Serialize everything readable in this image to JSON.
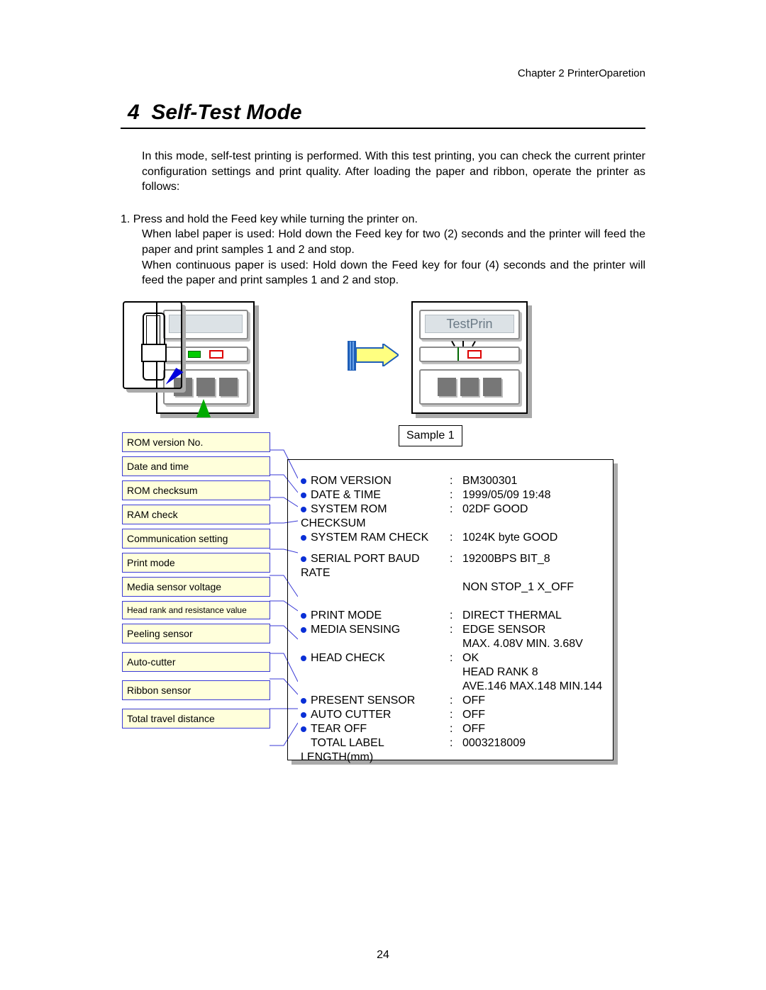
{
  "chapter": "Chapter 2    PrinterOparetion",
  "section_number": "4",
  "section_title": "Self-Test Mode",
  "intro": "In this mode, self-test printing is performed. With this test printing, you can check the current printer configuration settings and print quality. After loading the paper and ribbon, operate the printer as follows:",
  "step_lead": "1.  Press and hold the Feed key while turning the printer on.",
  "step_para1": "When label paper is used: Hold down the Feed key for two (2) seconds and the printer will feed the paper and print samples 1 and 2 and stop.",
  "step_para2": "When continuous paper is used: Hold down the Feed key for four (4) seconds and the printer will feed the paper and print samples 1 and 2 and stop.",
  "lcd_text": "TestPrin",
  "sample_label": "Sample 1",
  "callouts": [
    "ROM version No.",
    "Date and time",
    "ROM checksum",
    "RAM check",
    "Communication setting",
    "Print mode",
    "Media sensor voltage",
    "Head rank and resistance value",
    "Peeling sensor",
    "Auto-cutter",
    "Ribbon sensor",
    "Total travel distance"
  ],
  "printout": [
    {
      "bullet": true,
      "key": "ROM VERSION",
      "val": "BM300301"
    },
    {
      "bullet": true,
      "key": "DATE & TIME",
      "val": "1999/05/09  19:48"
    },
    {
      "bullet": true,
      "key": "SYSTEM ROM CHECKSUM",
      "val": "02DF GOOD"
    },
    {
      "bullet": true,
      "key": "SYSTEM RAM CHECK",
      "val": "1024K byte GOOD"
    },
    {
      "spacer": true
    },
    {
      "bullet": true,
      "key": "SERIAL PORT BAUD RATE",
      "val": "19200BPS BIT_8"
    },
    {
      "cont": "NON  STOP_1 X_OFF"
    },
    {
      "spacer": true
    },
    {
      "spacer": true
    },
    {
      "bullet": true,
      "key": "PRINT MODE",
      "val": "DIRECT THERMAL"
    },
    {
      "bullet": true,
      "key": "MEDIA SENSING",
      "val": "EDGE SENSOR"
    },
    {
      "cont": "MAX. 4.08V MIN. 3.68V"
    },
    {
      "bullet": true,
      "key": "HEAD CHECK",
      "val": "OK"
    },
    {
      "cont": "HEAD RANK 8"
    },
    {
      "cont": "AVE.146 MAX.148 MIN.144"
    },
    {
      "bullet": true,
      "key": "PRESENT SENSOR",
      "val": "OFF"
    },
    {
      "bullet": true,
      "key": "AUTO CUTTER",
      "val": "OFF"
    },
    {
      "bullet": true,
      "key": "TEAR OFF",
      "val": "OFF"
    },
    {
      "bullet": false,
      "key": "TOTAL LABEL LENGTH(mm)",
      "val": "0003218009"
    }
  ],
  "page_number": "24"
}
